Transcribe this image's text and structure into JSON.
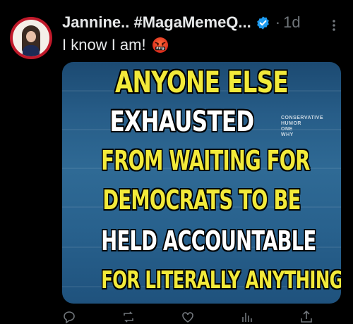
{
  "post": {
    "author": {
      "display_name": "Jannine.. #MagaMemeQ...",
      "verified": true
    },
    "separator": "·",
    "timestamp": "1d",
    "text": "I know I am!",
    "emoji": "face-with-symbols-on-mouth",
    "media": {
      "lines": [
        "ANYONE ELSE",
        "EXHAUSTED",
        "FROM WAITING FOR",
        "DEMOCRATS TO BE",
        "HELD ACCOUNTABLE",
        "FOR LITERALLY ANYTHING?"
      ],
      "watermark": [
        "CONSERVATIVE",
        "HUMOR",
        "ONE",
        "WHY"
      ]
    },
    "actions": [
      "reply-icon",
      "repost-icon",
      "like-icon",
      "views-icon",
      "share-icon"
    ]
  },
  "colors": {
    "background": "#000000",
    "text": "#e7e9ea",
    "muted": "#71767b",
    "verified": "#1d9bf0",
    "meme_yellow": "#f2ea3a",
    "meme_white": "#ffffff"
  }
}
